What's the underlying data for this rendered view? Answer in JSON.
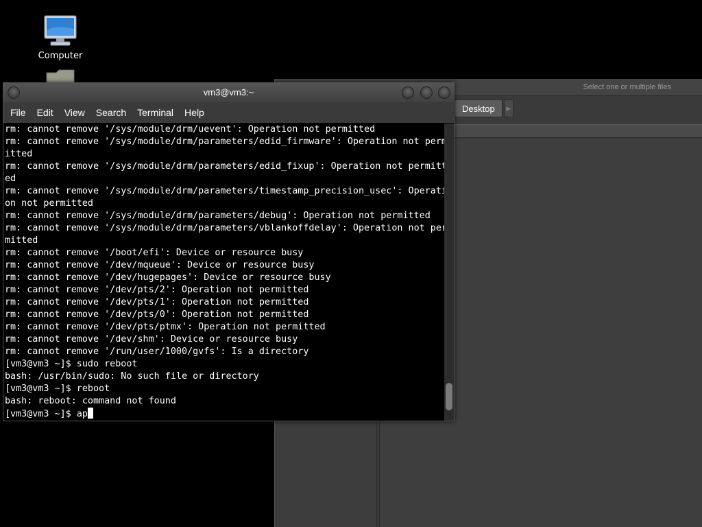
{
  "desktop": {
    "icons": [
      {
        "label": "Computer",
        "icon": "computer-icon"
      },
      {
        "label": "",
        "icon": "folder-icon"
      }
    ]
  },
  "file_chooser": {
    "title": "Select one or multiple files",
    "path_buttons": [
      "Desktop"
    ],
    "path_arrow": "right-arrow-icon"
  },
  "terminal": {
    "title": "vm3@vm3:~",
    "menu": [
      "File",
      "Edit",
      "View",
      "Search",
      "Terminal",
      "Help"
    ],
    "lines": [
      "rm: cannot remove '/sys/module/drm/uevent': Operation not permitted",
      "rm: cannot remove '/sys/module/drm/parameters/edid_firmware': Operation not perm",
      "itted",
      "rm: cannot remove '/sys/module/drm/parameters/edid_fixup': Operation not permitt",
      "ed",
      "rm: cannot remove '/sys/module/drm/parameters/timestamp_precision_usec': Operati",
      "on not permitted",
      "rm: cannot remove '/sys/module/drm/parameters/debug': Operation not permitted",
      "rm: cannot remove '/sys/module/drm/parameters/vblankoffdelay': Operation not per",
      "mitted",
      "rm: cannot remove '/boot/efi': Device or resource busy",
      "rm: cannot remove '/dev/mqueue': Device or resource busy",
      "rm: cannot remove '/dev/hugepages': Device or resource busy",
      "rm: cannot remove '/dev/pts/2': Operation not permitted",
      "rm: cannot remove '/dev/pts/1': Operation not permitted",
      "rm: cannot remove '/dev/pts/0': Operation not permitted",
      "rm: cannot remove '/dev/pts/ptmx': Operation not permitted",
      "rm: cannot remove '/dev/shm': Device or resource busy",
      "rm: cannot remove '/run/user/1000/gvfs': Is a directory",
      "[vm3@vm3 ~]$ sudo reboot",
      "bash: /usr/bin/sudo: No such file or directory",
      "[vm3@vm3 ~]$ reboot",
      "bash: reboot: command not found"
    ],
    "prompt": "[vm3@vm3 ~]$ ",
    "input": "ap"
  }
}
